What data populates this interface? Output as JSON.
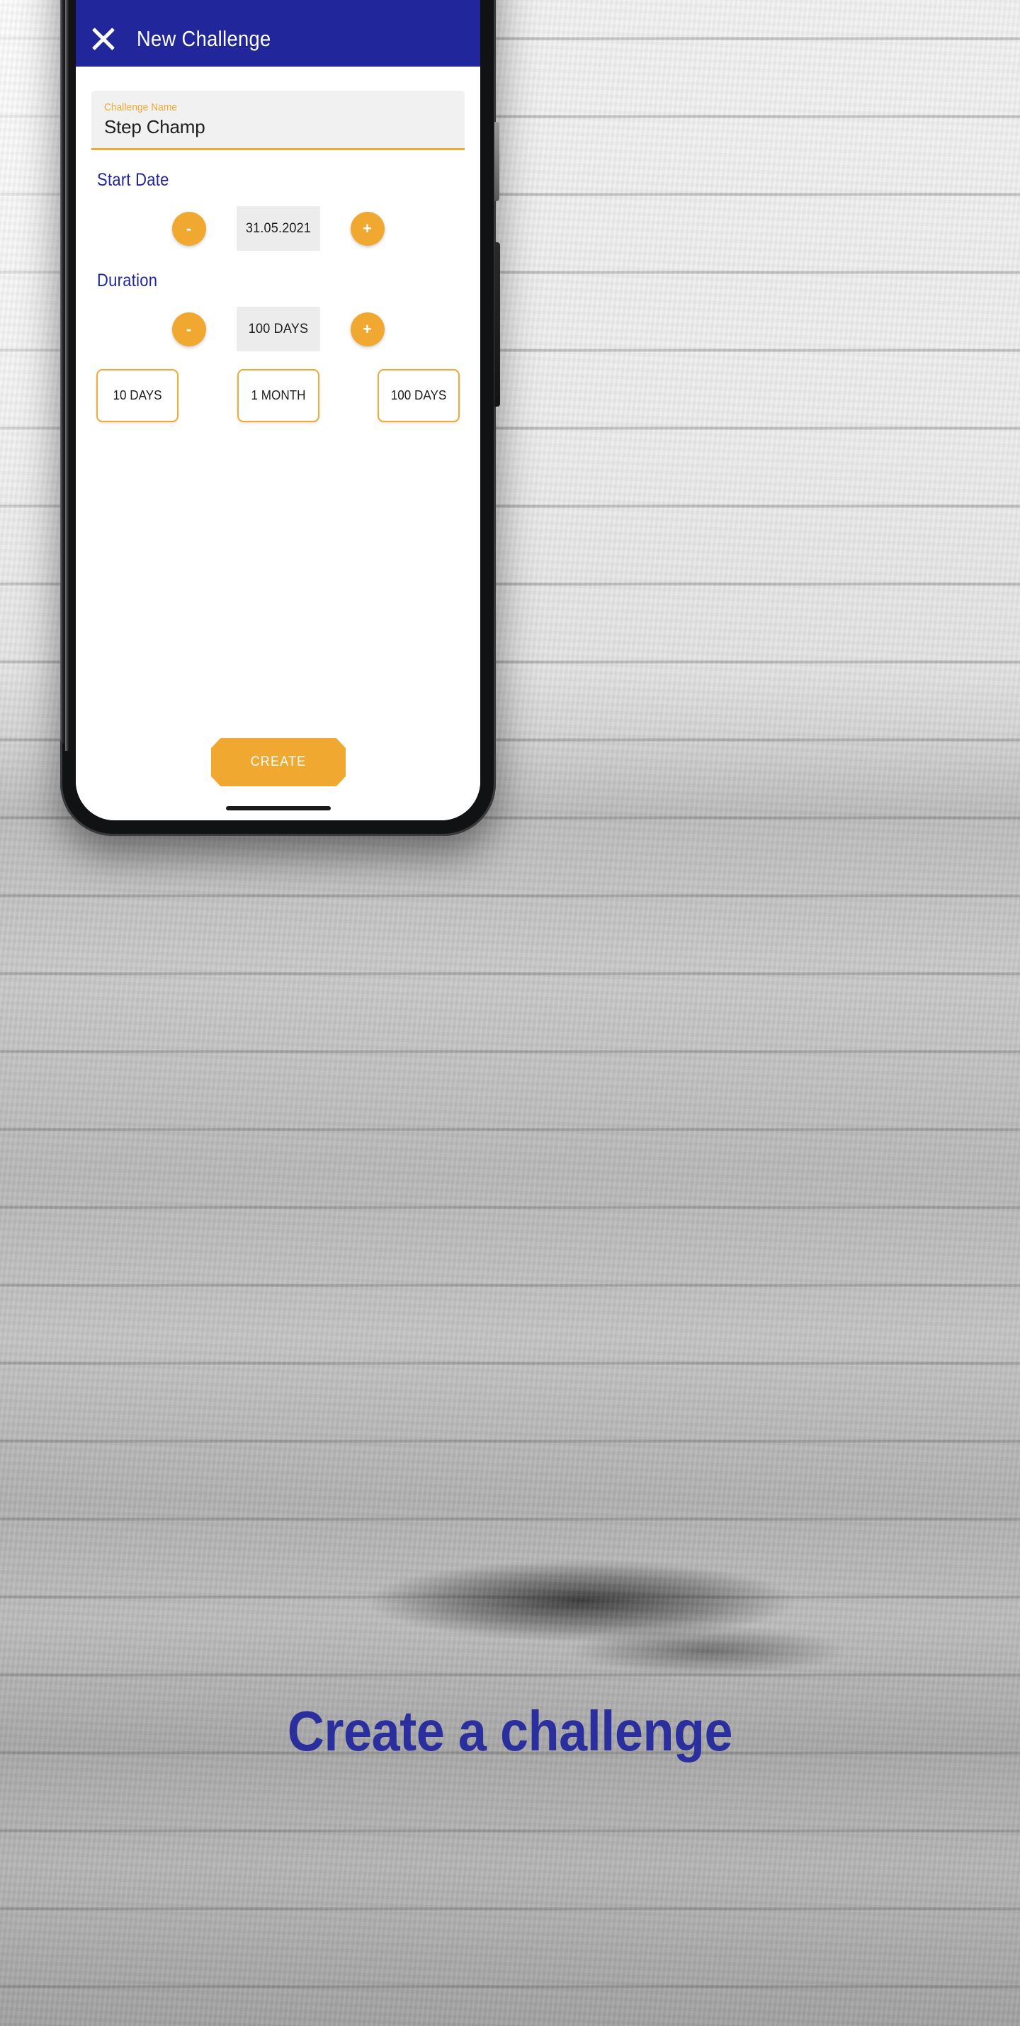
{
  "phone": {
    "header": {
      "close_icon": "close-x-icon",
      "title": "New Challenge"
    },
    "form": {
      "name_field": {
        "label": "Challenge Name",
        "value": "Step Champ",
        "placeholder": "Challenge Name"
      },
      "start_date": {
        "section_label": "Start Date",
        "decrement_label": "-",
        "value": "31.05.2021",
        "increment_label": "+"
      },
      "duration": {
        "section_label": "Duration",
        "decrement_label": "-",
        "value": "100 DAYS",
        "increment_label": "+",
        "presets": [
          {
            "label": "10 DAYS"
          },
          {
            "label": "1 MONTH"
          },
          {
            "label": "100 DAYS"
          }
        ]
      },
      "submit_label": "CREATE"
    }
  },
  "caption": "Create a challenge",
  "colors": {
    "brand_navy": "#22269b",
    "accent_orange": "#f0a830",
    "field_grey": "#f1f1f1",
    "value_grey": "#ececec",
    "text_dark": "#1d1d1d",
    "white": "#ffffff"
  }
}
